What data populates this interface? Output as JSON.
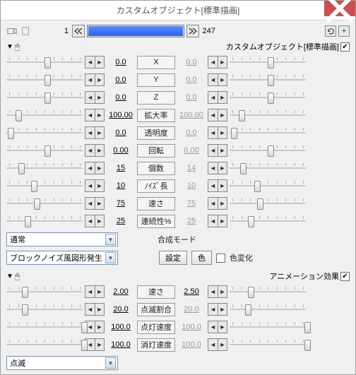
{
  "window": {
    "title": "カスタムオブジェクト[標準描画]"
  },
  "timeline": {
    "current": "1",
    "end": "247"
  },
  "sections": {
    "obj": {
      "label": "カスタムオブジェクト[標準描画]",
      "checked": "✔"
    },
    "anim": {
      "label": "アニメーション効果",
      "checked": "✔"
    }
  },
  "params_obj": [
    {
      "v1": "0.0",
      "label": "X",
      "v2": "0.0",
      "dim": true,
      "p1": 50,
      "p2": 50
    },
    {
      "v1": "0.0",
      "label": "Y",
      "v2": "0.0",
      "dim": true,
      "p1": 50,
      "p2": 50
    },
    {
      "v1": "0.0",
      "label": "Z",
      "v2": "0.0",
      "dim": true,
      "p1": 50,
      "p2": 50
    },
    {
      "v1": "100.00",
      "label": "拡大率",
      "v2": "100.00",
      "dim": true,
      "p1": 12,
      "p2": 12
    },
    {
      "v1": "0.0",
      "label": "透明度",
      "v2": "0.0",
      "dim": true,
      "p1": 2,
      "p2": 2
    },
    {
      "v1": "0.00",
      "label": "回転",
      "v2": "0.00",
      "dim": true,
      "p1": 50,
      "p2": 50
    },
    {
      "v1": "15",
      "label": "個数",
      "v2": "14",
      "dim": true,
      "p1": 16,
      "p2": 14
    },
    {
      "v1": "10",
      "label": "ﾉｲｽﾞ長",
      "v2": "10",
      "dim": true,
      "p1": 32,
      "p2": 32
    },
    {
      "v1": "75",
      "label": "速さ",
      "v2": "75",
      "dim": true,
      "p1": 36,
      "p2": 36
    },
    {
      "v1": "25",
      "label": "連続性%",
      "v2": "25",
      "dim": true,
      "p1": 24,
      "p2": 24
    }
  ],
  "blend": {
    "mode": "通常",
    "label": "合成モード"
  },
  "gen": {
    "mode": "ブロックノイズ風図形発生",
    "btn_set": "設定",
    "btn_color": "色",
    "cb_colorchange": "色変化"
  },
  "params_anim": [
    {
      "v1": "2.00",
      "label": "速さ",
      "v2": "2.50",
      "dim": false,
      "p1": 20,
      "p2": 24
    },
    {
      "v1": "20.0",
      "label": "点滅割合",
      "v2": "20.0",
      "dim": true,
      "p1": 20,
      "p2": 20
    },
    {
      "v1": "100.0",
      "label": "点灯速度",
      "v2": "100.0",
      "dim": true,
      "p1": 98,
      "p2": 98
    },
    {
      "v1": "100.0",
      "label": "消灯速度",
      "v2": "100.0",
      "dim": true,
      "p1": 98,
      "p2": 98
    }
  ],
  "effect": {
    "mode": "点滅"
  }
}
